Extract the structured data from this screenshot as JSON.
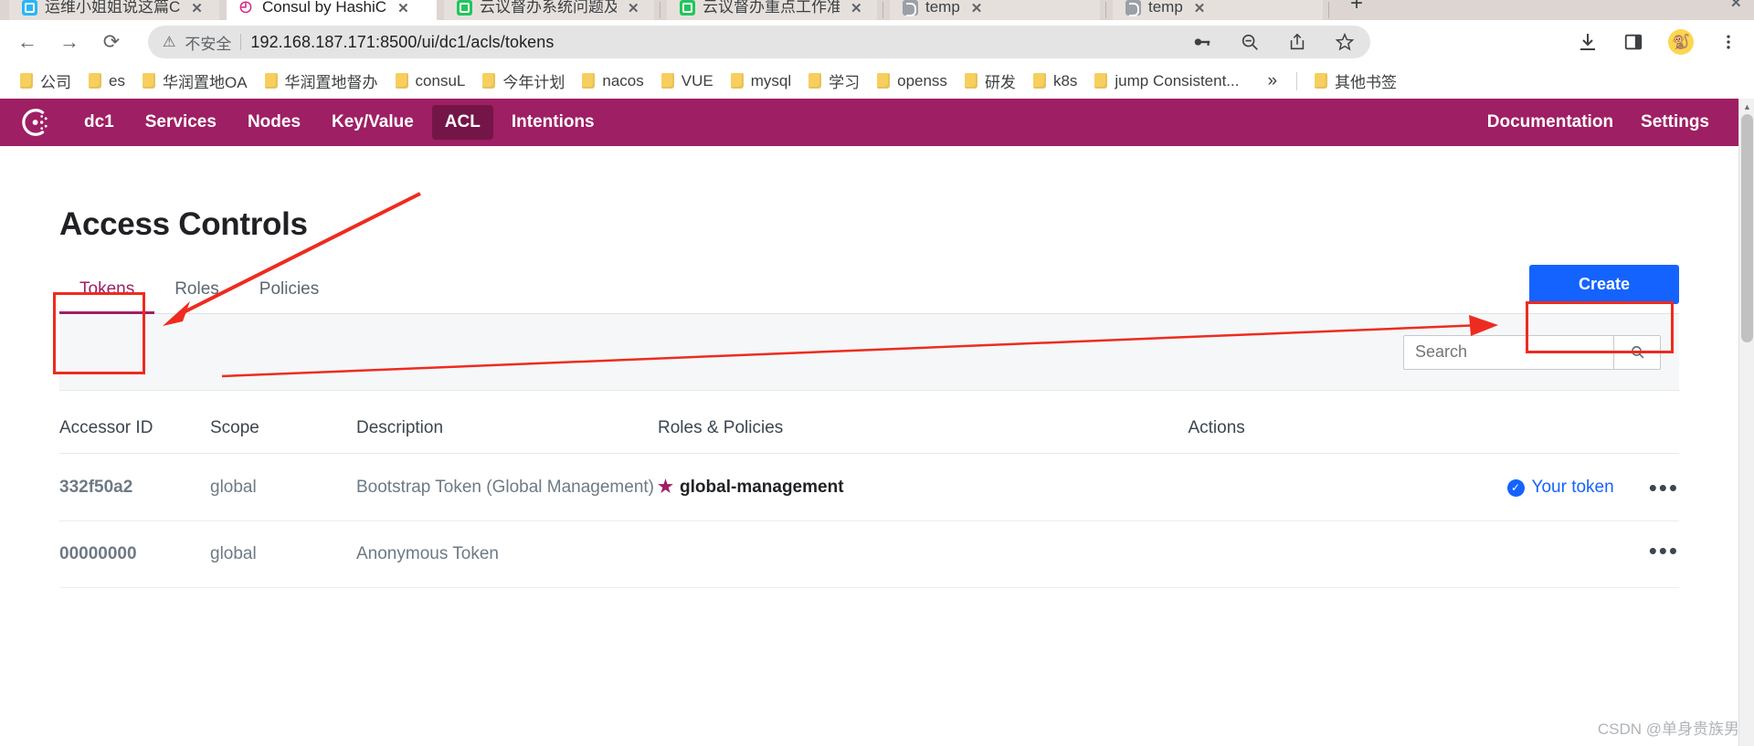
{
  "browser": {
    "tabs": [
      {
        "title": "运维小姐姐说这篇C",
        "favicon": "blue-doc-icon",
        "active": false
      },
      {
        "title": "Consul by HashiC",
        "favicon": "consul-icon",
        "active": true
      },
      {
        "title": "云议督办系统问题及",
        "favicon": "green-doc-icon",
        "active": false
      },
      {
        "title": "云议督办重点工作准",
        "favicon": "green-doc-icon",
        "active": false
      },
      {
        "title": "temp",
        "favicon": "grey-globe-icon",
        "active": false
      },
      {
        "title": "temp",
        "favicon": "grey-globe-icon",
        "active": false
      }
    ],
    "tab_close_label": "✕",
    "new_tab_label": "+",
    "nav": {
      "back": "←",
      "forward": "→",
      "reload": "⟳"
    },
    "omnibox": {
      "security_icon": "warning-triangle-icon",
      "security_text": "不安全",
      "url": "192.168.187.171:8500/ui/dc1/acls/tokens"
    },
    "toolbar_icons": [
      "key-icon",
      "zoom-out-icon",
      "share-icon",
      "bookmark-star-icon",
      "download-icon",
      "side-panel-icon",
      "profile-avatar",
      "chrome-menu-icon"
    ],
    "avatar_glyph": "🐒",
    "bookmarks": [
      "公司",
      "es",
      "华润置地OA",
      "华润置地督办",
      "consuL",
      "今年计划",
      "nacos",
      "VUE",
      "mysql",
      "学习",
      "openss",
      "研发",
      "k8s",
      "jump Consistent..."
    ],
    "bookmarks_overflow": "»",
    "other_bookmarks": "其他书签"
  },
  "consul": {
    "brand_color": "#9e1f63",
    "accent_blue": "#1563ff",
    "nav_items": [
      {
        "label": "dc1",
        "active": false
      },
      {
        "label": "Services",
        "active": false
      },
      {
        "label": "Nodes",
        "active": false
      },
      {
        "label": "Key/Value",
        "active": false
      },
      {
        "label": "ACL",
        "active": true
      },
      {
        "label": "Intentions",
        "active": false
      }
    ],
    "nav_right": [
      {
        "label": "Documentation"
      },
      {
        "label": "Settings"
      }
    ],
    "page_title": "Access Controls",
    "tabs": [
      {
        "label": "Tokens",
        "active": true
      },
      {
        "label": "Roles",
        "active": false
      },
      {
        "label": "Policies",
        "active": false
      }
    ],
    "create_button": "Create",
    "search": {
      "value": "",
      "placeholder": "Search",
      "icon": "search-icon"
    },
    "table": {
      "columns": [
        "Accessor ID",
        "Scope",
        "Description",
        "Roles & Policies",
        "Actions"
      ],
      "rows": [
        {
          "accessor_id": "332f50a2",
          "scope": "global",
          "description": "Bootstrap Token (Global Management)",
          "role": "global-management",
          "role_icon": "star-icon",
          "status": "Your token",
          "status_icon": "check-circle-icon",
          "menu": "•••"
        },
        {
          "accessor_id": "00000000",
          "scope": "global",
          "description": "Anonymous Token",
          "role": "",
          "role_icon": "",
          "status": "",
          "status_icon": "",
          "menu": "•••"
        }
      ]
    }
  },
  "watermark": "CSDN @单身贵族男"
}
